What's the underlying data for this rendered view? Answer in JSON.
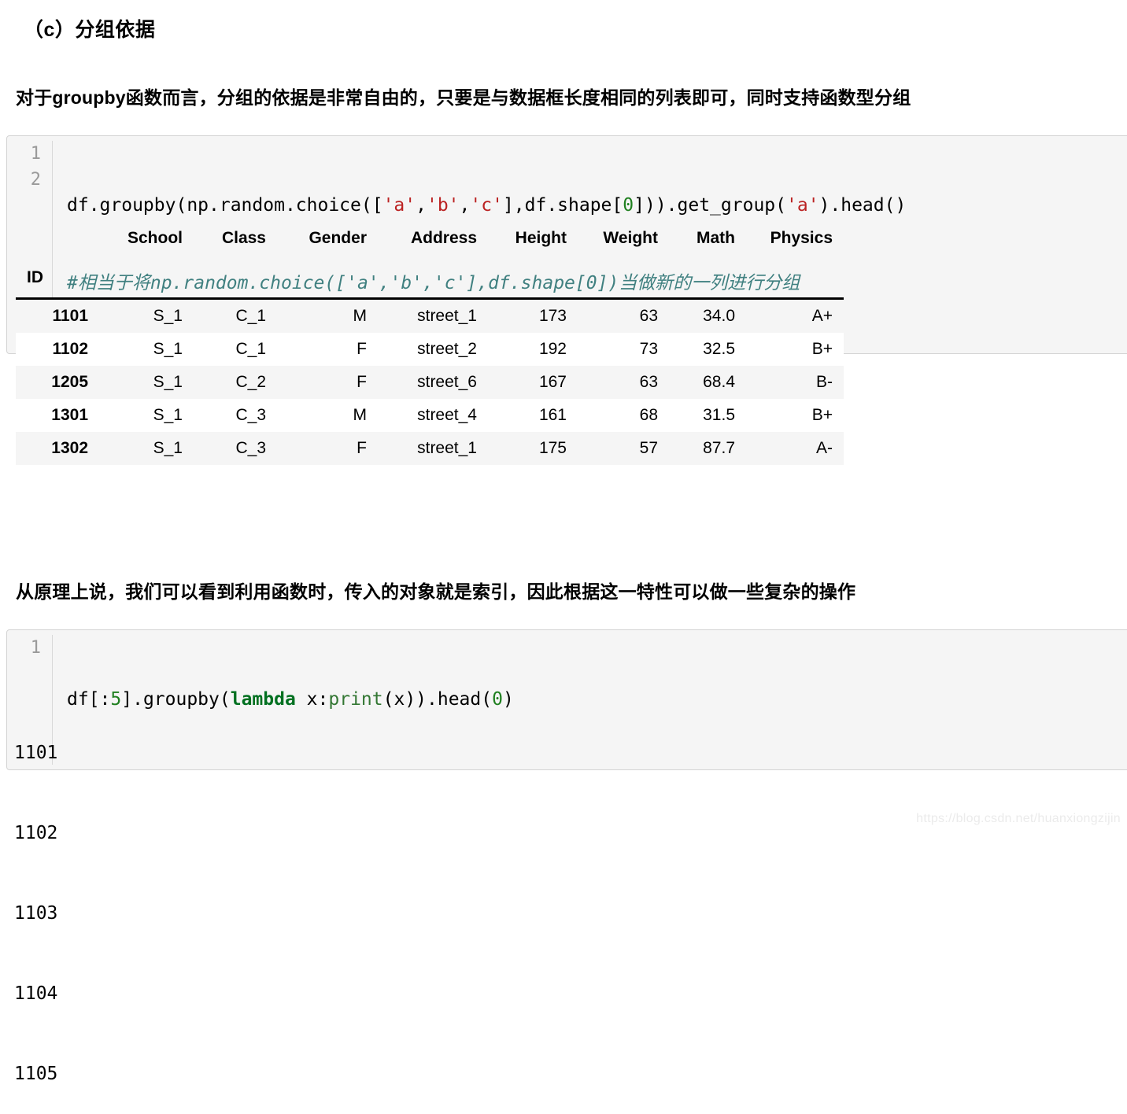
{
  "section": {
    "title": "（c）分组依据"
  },
  "prose": {
    "p1": "对于groupby函数而言，分组的依据是非常自由的，只要是与数据框长度相同的列表即可，同时支持函数型分组",
    "p2": "从原理上说，我们可以看到利用函数时，传入的对象就是索引，因此根据这一特性可以做一些复杂的操作"
  },
  "code_block_1": {
    "line_numbers": [
      "1",
      "2"
    ],
    "line1": {
      "t1": "df.groupby(np.random.choice([",
      "s1": "'a'",
      "t2": ",",
      "s2": "'b'",
      "t3": ",",
      "s3": "'c'",
      "t4": "],df.shape[",
      "n1": "0",
      "t5": "])).get_group(",
      "s4": "'a'",
      "t6": ").head()"
    },
    "line2": {
      "comment": "#相当于将np.random.choice(['a','b','c'],df.shape[0])当做新的一列进行分组"
    }
  },
  "code_block_2": {
    "line_numbers": [
      "1"
    ],
    "line1": {
      "t1": "df[:",
      "n1": "5",
      "t2": "].groupby(",
      "kw": "lambda",
      "t3": " x:",
      "fn": "print",
      "t4": "(x)).head(",
      "n2": "0",
      "t5": ")"
    }
  },
  "dataframe": {
    "columns": [
      "School",
      "Class",
      "Gender",
      "Address",
      "Height",
      "Weight",
      "Math",
      "Physics"
    ],
    "index_name": "ID",
    "rows": [
      {
        "id": "1101",
        "School": "S_1",
        "Class": "C_1",
        "Gender": "M",
        "Address": "street_1",
        "Height": "173",
        "Weight": "63",
        "Math": "34.0",
        "Physics": "A+"
      },
      {
        "id": "1102",
        "School": "S_1",
        "Class": "C_1",
        "Gender": "F",
        "Address": "street_2",
        "Height": "192",
        "Weight": "73",
        "Math": "32.5",
        "Physics": "B+"
      },
      {
        "id": "1205",
        "School": "S_1",
        "Class": "C_2",
        "Gender": "F",
        "Address": "street_6",
        "Height": "167",
        "Weight": "63",
        "Math": "68.4",
        "Physics": "B-"
      },
      {
        "id": "1301",
        "School": "S_1",
        "Class": "C_3",
        "Gender": "M",
        "Address": "street_4",
        "Height": "161",
        "Weight": "68",
        "Math": "31.5",
        "Physics": "B+"
      },
      {
        "id": "1302",
        "School": "S_1",
        "Class": "C_3",
        "Gender": "F",
        "Address": "street_1",
        "Height": "175",
        "Weight": "57",
        "Math": "87.7",
        "Physics": "A-"
      }
    ]
  },
  "stdout": {
    "lines": [
      "1101",
      "1102",
      "1103",
      "1104",
      "1105"
    ]
  },
  "watermark": {
    "text": "https://blog.csdn.net/huanxiongzijin"
  },
  "colors": {
    "code_bg": "#f5f5f5",
    "code_border": "#d4d4d4",
    "gutter_text": "#9a9a9a",
    "string": "#bb2222",
    "number": "#208020",
    "keyword": "#007020",
    "function": "#337733",
    "comment": "#408080",
    "row_stripe": "#f5f5f5",
    "watermark": "#ebebeb"
  }
}
